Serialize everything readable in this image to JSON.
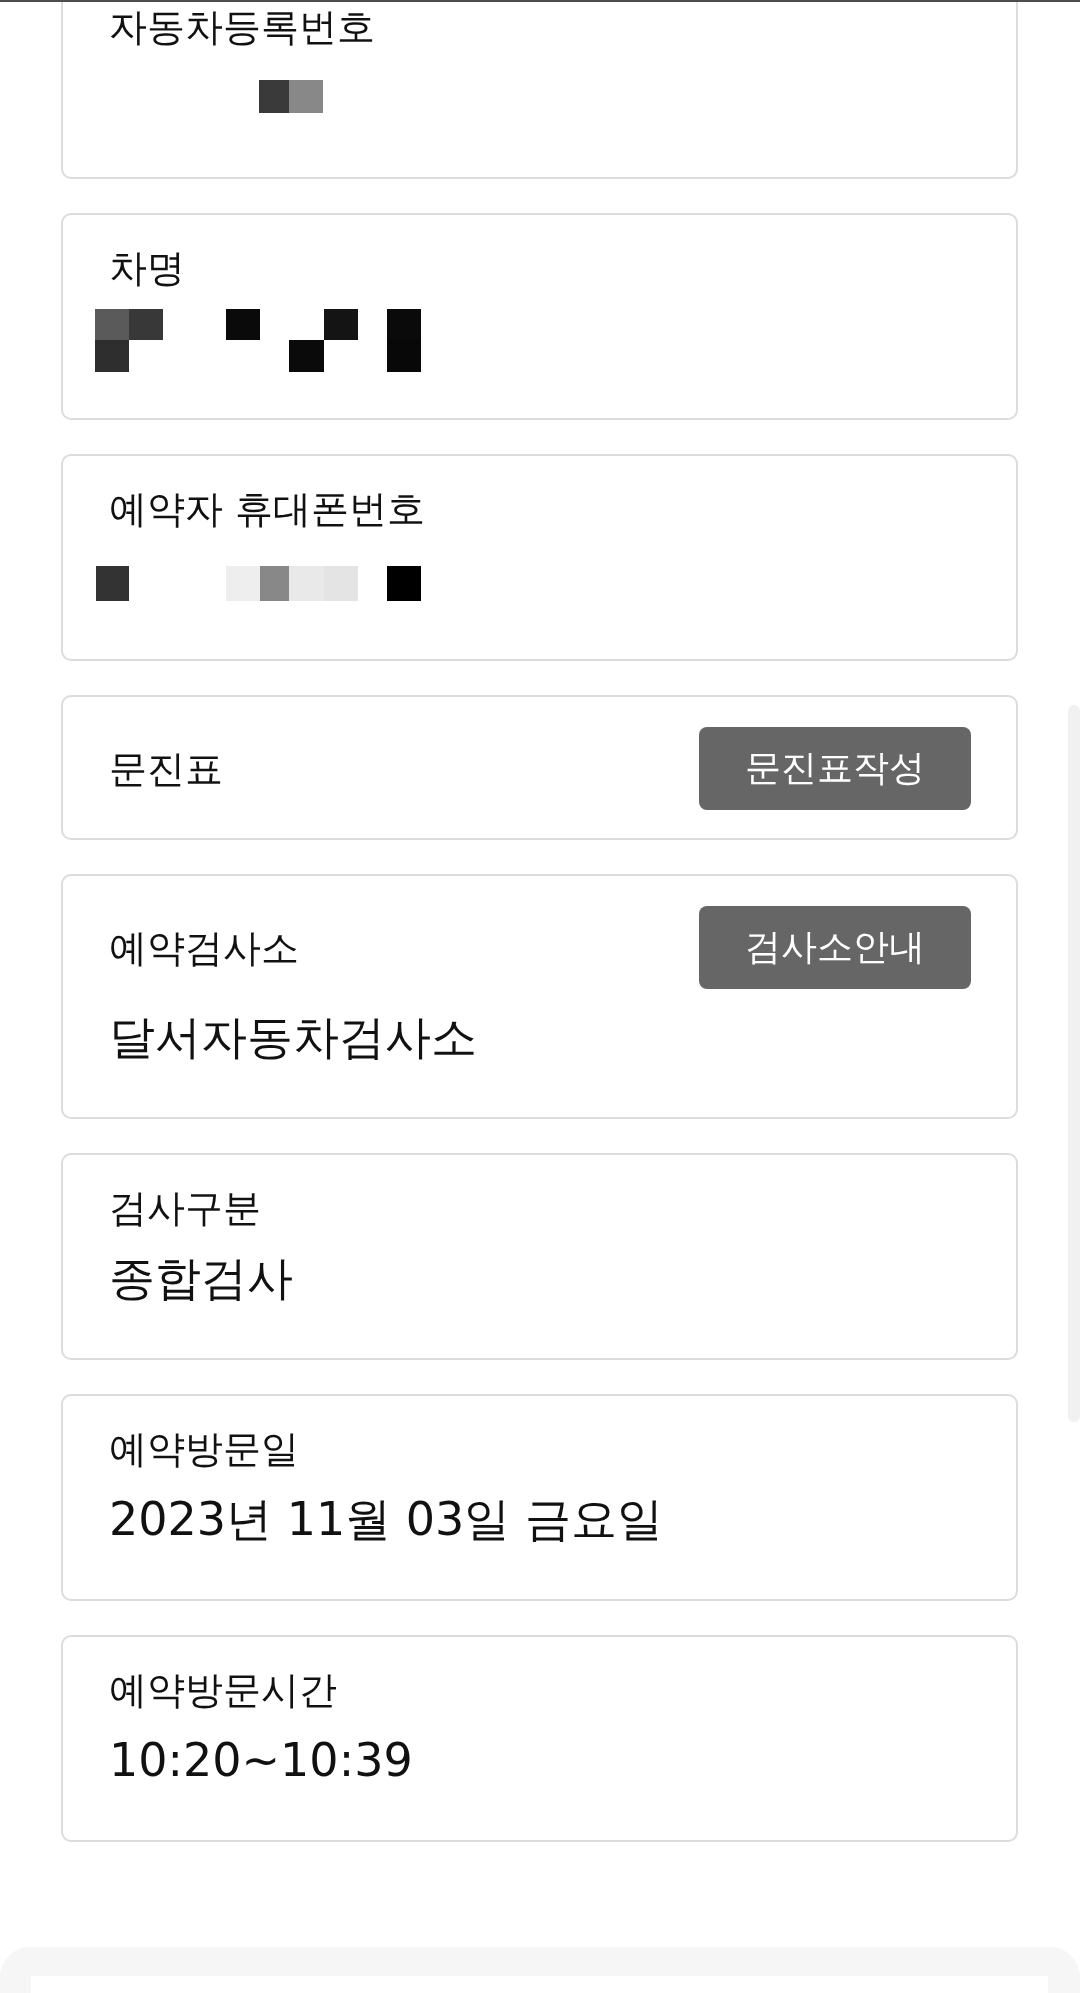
{
  "fields": [
    {
      "kind": "masked",
      "label": "자동차등록번호"
    },
    {
      "kind": "masked",
      "label": "차명"
    },
    {
      "kind": "masked",
      "label": "예약자 휴대폰번호"
    },
    {
      "kind": "plain",
      "label": "문진표",
      "button": "문진표작성"
    },
    {
      "kind": "plain",
      "label": "예약검사소",
      "button": "검사소안내",
      "value": "달서자동차검사소"
    },
    {
      "kind": "plain",
      "label": "검사구분",
      "value": "종합검사"
    },
    {
      "kind": "plain",
      "label": "예약방문일",
      "value": "2023년 11월 03일 금요일"
    },
    {
      "kind": "plain",
      "label": "예약방문시간",
      "value": "10:20~10:39"
    }
  ]
}
